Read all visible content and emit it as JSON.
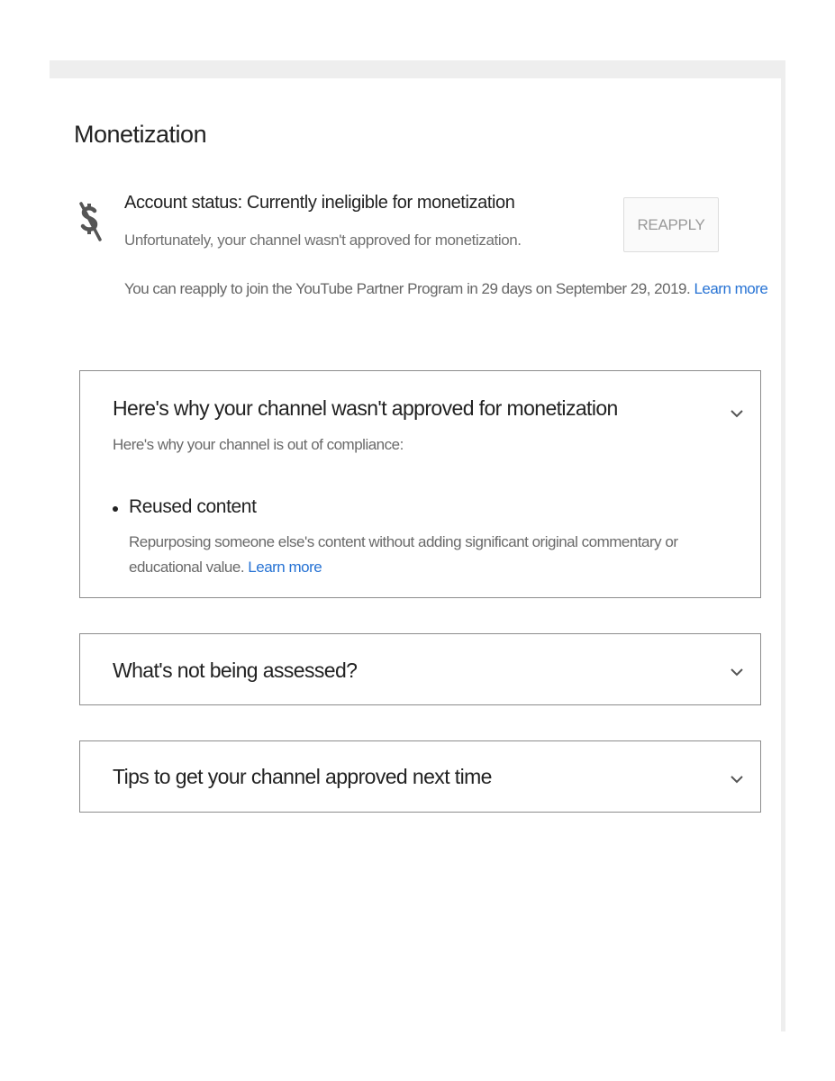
{
  "page": {
    "title": "Monetization"
  },
  "status": {
    "icon": "no-money-icon",
    "title": "Account status: Currently ineligible for monetization",
    "subtitle": "Unfortunately, your channel wasn't approved for monetization.",
    "reapply_label": "REAPPLY",
    "reapply_note": "You can reapply to join the YouTube Partner Program in 29 days on September 29, 2019.",
    "learn_more": "Learn more"
  },
  "sections": [
    {
      "title": "Here's why your channel wasn't approved for monetization",
      "subtitle": "Here's why your channel is out of compliance:",
      "reasons": [
        {
          "title": "Reused content",
          "description": "Repurposing someone else's content without adding significant original commentary or educational value.",
          "learn_more": "Learn more"
        }
      ],
      "expanded": true
    },
    {
      "title": "What's not being assessed?",
      "expanded": false
    },
    {
      "title": "Tips to get your channel approved next time",
      "expanded": false
    }
  ],
  "colors": {
    "link": "#2773d4",
    "border": "#8c8c8c",
    "muted_text": "#6a6a6a"
  }
}
